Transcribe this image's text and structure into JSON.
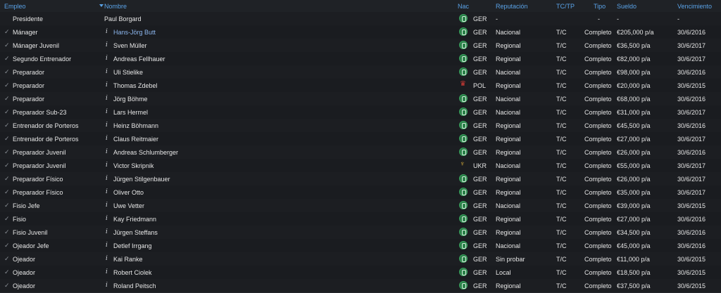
{
  "headers": {
    "empleo": "Empleo",
    "nombre": "Nombre",
    "nac": "Nac",
    "reputacion": "Reputación",
    "tctp": "TC/TP",
    "tipo": "Tipo",
    "sueldo": "Sueldo",
    "vencimiento": "Vencimiento"
  },
  "rows": [
    {
      "empleo": "Presidente",
      "nombre": "Paul Borgard",
      "nac": "GER",
      "rep": "-",
      "tctp": "",
      "tipo": "-",
      "sueldo": "-",
      "venc": "-"
    },
    {
      "empleo": "Mánager",
      "nombre": "Hans-Jörg Butt",
      "nac": "GER",
      "rep": "Nacional",
      "tctp": "T/C",
      "tipo": "Completo",
      "sueldo": "€205,000 p/a",
      "venc": "30/6/2016"
    },
    {
      "empleo": "Mánager Juvenil",
      "nombre": "Sven Müller",
      "nac": "GER",
      "rep": "Regional",
      "tctp": "T/C",
      "tipo": "Completo",
      "sueldo": "€36,500 p/a",
      "venc": "30/6/2017"
    },
    {
      "empleo": "Segundo Entrenador",
      "nombre": "Andreas Fellhauer",
      "nac": "GER",
      "rep": "Regional",
      "tctp": "T/C",
      "tipo": "Completo",
      "sueldo": "€82,000 p/a",
      "venc": "30/6/2017"
    },
    {
      "empleo": "Preparador",
      "nombre": "Uli Stielike",
      "nac": "GER",
      "rep": "Nacional",
      "tctp": "T/C",
      "tipo": "Completo",
      "sueldo": "€98,000 p/a",
      "venc": "30/6/2016"
    },
    {
      "empleo": "Preparador",
      "nombre": "Thomas Zdebel",
      "nac": "POL",
      "rep": "Regional",
      "tctp": "T/C",
      "tipo": "Completo",
      "sueldo": "€20,000 p/a",
      "venc": "30/6/2015"
    },
    {
      "empleo": "Preparador",
      "nombre": "Jörg Böhme",
      "nac": "GER",
      "rep": "Nacional",
      "tctp": "T/C",
      "tipo": "Completo",
      "sueldo": "€68,000 p/a",
      "venc": "30/6/2016"
    },
    {
      "empleo": "Preparador Sub-23",
      "nombre": "Lars Hermel",
      "nac": "GER",
      "rep": "Nacional",
      "tctp": "T/C",
      "tipo": "Completo",
      "sueldo": "€31,000 p/a",
      "venc": "30/6/2017"
    },
    {
      "empleo": "Entrenador de Porteros",
      "nombre": "Heinz Böhmann",
      "nac": "GER",
      "rep": "Regional",
      "tctp": "T/C",
      "tipo": "Completo",
      "sueldo": "€45,500 p/a",
      "venc": "30/6/2016"
    },
    {
      "empleo": "Entrenador de Porteros",
      "nombre": "Claus Reitmaier",
      "nac": "GER",
      "rep": "Regional",
      "tctp": "T/C",
      "tipo": "Completo",
      "sueldo": "€27,000 p/a",
      "venc": "30/6/2017"
    },
    {
      "empleo": "Preparador Juvenil",
      "nombre": "Andreas Schlumberger",
      "nac": "GER",
      "rep": "Regional",
      "tctp": "T/C",
      "tipo": "Completo",
      "sueldo": "€26,000 p/a",
      "venc": "30/6/2016"
    },
    {
      "empleo": "Preparador Juvenil",
      "nombre": "Victor Skripnik",
      "nac": "UKR",
      "rep": "Nacional",
      "tctp": "T/C",
      "tipo": "Completo",
      "sueldo": "€55,000 p/a",
      "venc": "30/6/2017"
    },
    {
      "empleo": "Preparador Físico",
      "nombre": "Jürgen Stilgenbauer",
      "nac": "GER",
      "rep": "Regional",
      "tctp": "T/C",
      "tipo": "Completo",
      "sueldo": "€26,000 p/a",
      "venc": "30/6/2017"
    },
    {
      "empleo": "Preparador Físico",
      "nombre": "Oliver Otto",
      "nac": "GER",
      "rep": "Regional",
      "tctp": "T/C",
      "tipo": "Completo",
      "sueldo": "€35,000 p/a",
      "venc": "30/6/2017"
    },
    {
      "empleo": "Fisio Jefe",
      "nombre": "Uwe Vetter",
      "nac": "GER",
      "rep": "Nacional",
      "tctp": "T/C",
      "tipo": "Completo",
      "sueldo": "€39,000 p/a",
      "venc": "30/6/2015"
    },
    {
      "empleo": "Fisio",
      "nombre": "Kay Friedmann",
      "nac": "GER",
      "rep": "Regional",
      "tctp": "T/C",
      "tipo": "Completo",
      "sueldo": "€27,000 p/a",
      "venc": "30/6/2016"
    },
    {
      "empleo": "Fisio Juvenil",
      "nombre": "Jürgen Steffans",
      "nac": "GER",
      "rep": "Regional",
      "tctp": "T/C",
      "tipo": "Completo",
      "sueldo": "€34,500 p/a",
      "venc": "30/6/2016"
    },
    {
      "empleo": "Ojeador Jefe",
      "nombre": "Detlef Irrgang",
      "nac": "GER",
      "rep": "Nacional",
      "tctp": "T/C",
      "tipo": "Completo",
      "sueldo": "€45,000 p/a",
      "venc": "30/6/2016"
    },
    {
      "empleo": "Ojeador",
      "nombre": "Kai Ranke",
      "nac": "GER",
      "rep": "Sin probar",
      "tctp": "T/C",
      "tipo": "Completo",
      "sueldo": "€11,000 p/a",
      "venc": "30/6/2015"
    },
    {
      "empleo": "Ojeador",
      "nombre": "Robert Ciolek",
      "nac": "GER",
      "rep": "Local",
      "tctp": "T/C",
      "tipo": "Completo",
      "sueldo": "€18,500 p/a",
      "venc": "30/6/2015"
    },
    {
      "empleo": "Ojeador",
      "nombre": "Roland Peitsch",
      "nac": "GER",
      "rep": "Regional",
      "tctp": "T/C",
      "tipo": "Completo",
      "sueldo": "€37,500 p/a",
      "venc": "30/6/2015"
    }
  ],
  "highlighted_name_color": "#8cb6ee",
  "header_color": "#5aa3e8"
}
